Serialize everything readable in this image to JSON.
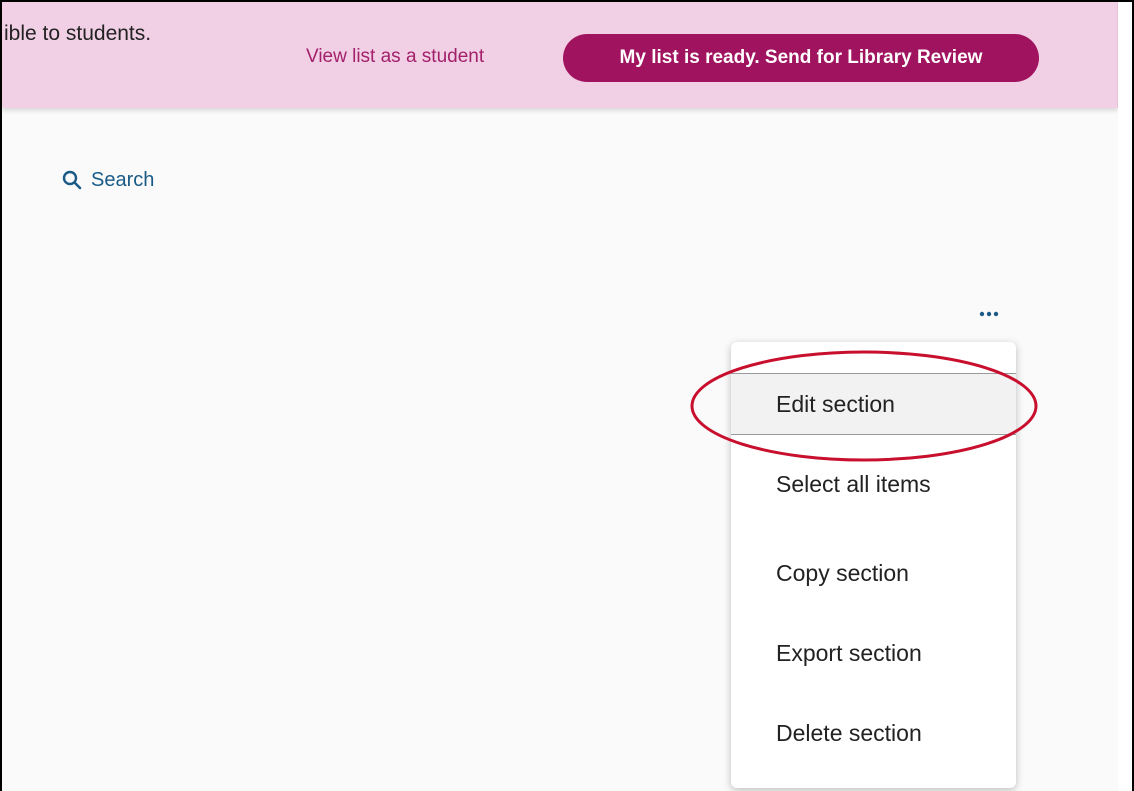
{
  "banner": {
    "message": "ible to students.",
    "view_as_student_label": "View list as a student",
    "send_review_label": "My list is ready. Send for Library Review"
  },
  "search": {
    "label": "Search",
    "icon": "search-icon"
  },
  "section_actions": {
    "more_icon": "more-horizontal-icon",
    "more_glyph": "•••",
    "items": [
      {
        "label": "Edit section",
        "highlighted": true
      },
      {
        "label": "Select all items"
      },
      {
        "label": "Copy section"
      },
      {
        "label": "Export section"
      },
      {
        "label": "Delete section"
      }
    ]
  },
  "colors": {
    "banner_bg": "#f1d0e5",
    "accent_magenta": "#a0135f",
    "link_blue": "#1a5b86",
    "annotation_red": "#c8102e"
  }
}
